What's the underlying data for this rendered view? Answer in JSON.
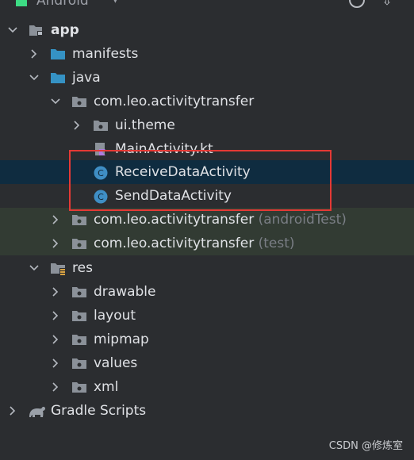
{
  "header": {
    "title": "Android",
    "dropdown_icon": "chevron-down-icon",
    "tools": [
      "target-icon",
      "collapse-icon"
    ]
  },
  "tree": [
    {
      "label": "app",
      "bold": true,
      "expanded": true,
      "icon": "module-folder-icon"
    },
    {
      "label": "manifests",
      "expanded": false,
      "icon": "folder-icon"
    },
    {
      "label": "java",
      "expanded": true,
      "icon": "folder-icon"
    },
    {
      "label": "com.leo.activitytransfer",
      "expanded": true,
      "icon": "package-icon"
    },
    {
      "label": "ui.theme",
      "expanded": false,
      "icon": "package-icon"
    },
    {
      "label": "MainActivity.kt",
      "icon": "kotlin-file-icon"
    },
    {
      "label": "ReceiveDataActivity",
      "icon": "class-icon",
      "selected": true
    },
    {
      "label": "SendDataActivity",
      "icon": "class-icon"
    },
    {
      "label": "com.leo.activitytransfer",
      "suffix": "(androidTest)",
      "expanded": false,
      "icon": "package-icon"
    },
    {
      "label": "com.leo.activitytransfer",
      "suffix": "(test)",
      "expanded": false,
      "icon": "package-icon"
    },
    {
      "label": "res",
      "expanded": true,
      "icon": "res-folder-icon"
    },
    {
      "label": "drawable",
      "expanded": false,
      "icon": "package-icon"
    },
    {
      "label": "layout",
      "expanded": false,
      "icon": "package-icon"
    },
    {
      "label": "mipmap",
      "expanded": false,
      "icon": "package-icon"
    },
    {
      "label": "values",
      "expanded": false,
      "icon": "package-icon"
    },
    {
      "label": "xml",
      "expanded": false,
      "icon": "package-icon"
    },
    {
      "label": "Gradle Scripts",
      "expanded": false,
      "icon": "gradle-icon"
    }
  ],
  "watermark": "CSDN @修炼室",
  "colors": {
    "background": "#2b2d30",
    "selected_row": "#0f2c40",
    "test_rows": "#323b33",
    "highlight_box": "#e53935",
    "folder_blue": "#3592c4",
    "class_icon": "#3f8ec4"
  }
}
